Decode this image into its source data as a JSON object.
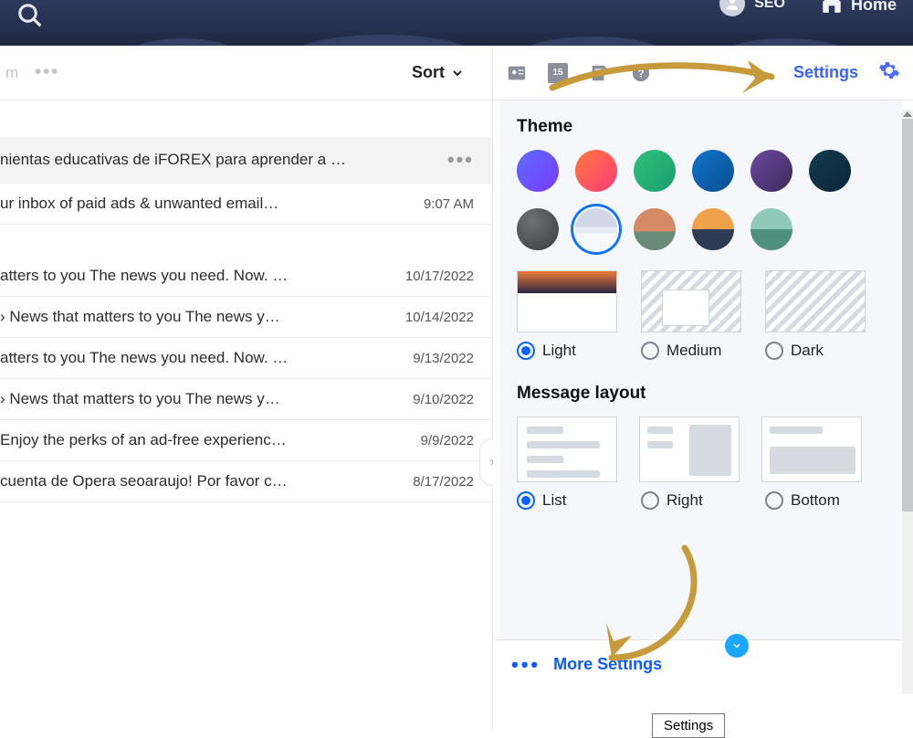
{
  "header": {
    "user_name": "SEO",
    "home_label": "Home"
  },
  "subheader": {
    "left_cut_text": "m",
    "sort_label": "Sort"
  },
  "toolbar": {
    "calendar_day": "15",
    "settings_link": "Settings"
  },
  "mail": {
    "rows": [
      {
        "subject": "nientas educativas de iFOREX para aprender a inve…",
        "time": "",
        "selected": true
      },
      {
        "subject": "ur inbox of paid ads & unwanted email…",
        "time": "9:07 AM"
      },
      {
        "subject": "atters to you The news you need. Now. …",
        "time": "10/17/2022"
      },
      {
        "subject": "›  News that matters to you The news y…",
        "time": "10/14/2022"
      },
      {
        "subject": "atters to you The news you need. Now. …",
        "time": "9/13/2022"
      },
      {
        "subject": "›  News that matters to you The news y…",
        "time": "9/10/2022"
      },
      {
        "subject": "Enjoy the perks of an ad-free experienc…",
        "time": "9/9/2022"
      },
      {
        "subject": "cuenta de Opera seoaraujo! Por favor c…",
        "time": "8/17/2022"
      }
    ]
  },
  "settings_panel": {
    "theme_title": "Theme",
    "density_options": {
      "light": "Light",
      "medium": "Medium",
      "dark": "Dark"
    },
    "layout_title": "Message layout",
    "layout_options": {
      "list": "List",
      "right": "Right",
      "bottom": "Bottom"
    },
    "more_settings": "More Settings",
    "tooltip": "Settings",
    "swatches_row1": [
      "linear-gradient(135deg,#5b6bff,#7a3bff)",
      "linear-gradient(135deg,#ff7a3b,#ff3b7a)",
      "linear-gradient(135deg,#2fc07a,#1a9e6e)",
      "linear-gradient(135deg,#1173c9,#0a4f8f)",
      "linear-gradient(135deg,#6b4a9e,#3b2a5c)",
      "linear-gradient(135deg,#143a4f,#0a2838)"
    ],
    "swatches_row2_first": "radial-gradient(circle at 35% 30%, #6d7075, #3a3c40)"
  }
}
